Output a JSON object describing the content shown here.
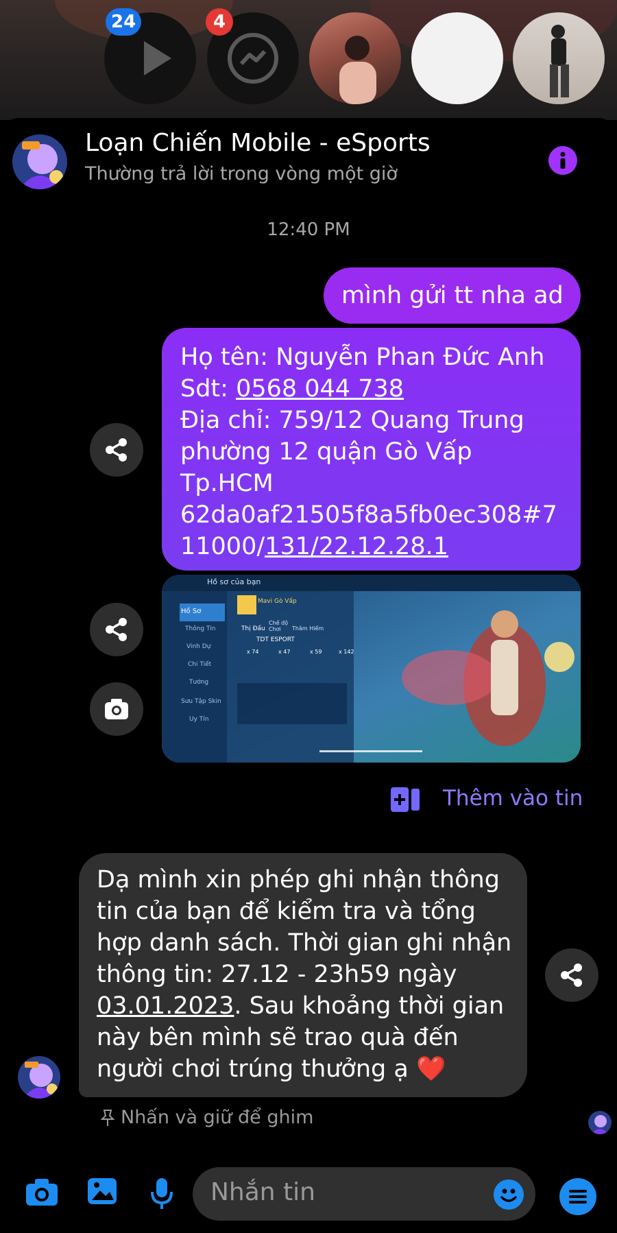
{
  "chat_heads": [
    {
      "name": "video-app",
      "badge": "24"
    },
    {
      "name": "messenger",
      "badge": "4"
    },
    {
      "name": "contact-photo-1",
      "badge": ""
    },
    {
      "name": "contact-blank",
      "badge": ""
    },
    {
      "name": "contact-photo-2",
      "badge": ""
    }
  ],
  "header": {
    "title": "Loạn Chiến Mobile - eSports",
    "subtitle": "Thường trả lời trong vòng một giờ"
  },
  "timestamp": "12:40 PM",
  "messages": {
    "sent_1": "mình gửi tt nha ad",
    "sent_2": {
      "line1": "Họ tên: Nguyễn Phan Đức Anh",
      "line2_prefix": "Sdt: ",
      "line2_link": "0568 044 738",
      "line3": "Địa chỉ: 759/12 Quang Trung",
      "line4": "phường 12 quận Gò Vấp",
      "line5": "Tp.HCM",
      "line6": "62da0af21505f8a5fb0ec308#7",
      "line7_prefix": "11000/",
      "line7_link": "131/22.12.28.1"
    },
    "received": {
      "line1": "Dạ mình xin phép ghi nhận thông",
      "line2": "tin của bạn để kiểm tra và tổng",
      "line3": "hợp danh sách. Thời gian ghi nhận",
      "line4": "thông tin: 27.12 - 23h59 ngày",
      "line5_link": "03.01.2023",
      "line5_suffix": ". Sau khoảng thời gian",
      "line6": "này bên mình sẽ trao quà đến",
      "line7": "người chơi trúng thưởng ạ ❤️"
    }
  },
  "add_to_story": "Thêm vào tin",
  "pin_hint": "Nhấn và giữ để ghim",
  "screenshot": {
    "title": "Hồ sơ của bạn",
    "menu": [
      "Hồ Sơ",
      "Thông Tin",
      "Vinh Dự",
      "Chi Tiết",
      "Tướng",
      "Sưu Tập Skin",
      "Uy Tín"
    ],
    "tabs": [
      "Thị Đấu",
      "Chế độ Chơi",
      "Thâm Hiểm"
    ],
    "player": "Mavi Gò Vấp",
    "team": "TDT ESPORT",
    "stats": [
      "x 74",
      "x 47",
      "x 59",
      "x 142"
    ]
  },
  "composer": {
    "placeholder": "Nhắn tin"
  },
  "colors": {
    "sent_bubble": "#8b2ef5",
    "received_bubble": "#303030",
    "accent": "#1d8cf0",
    "info": "#a033ff"
  }
}
